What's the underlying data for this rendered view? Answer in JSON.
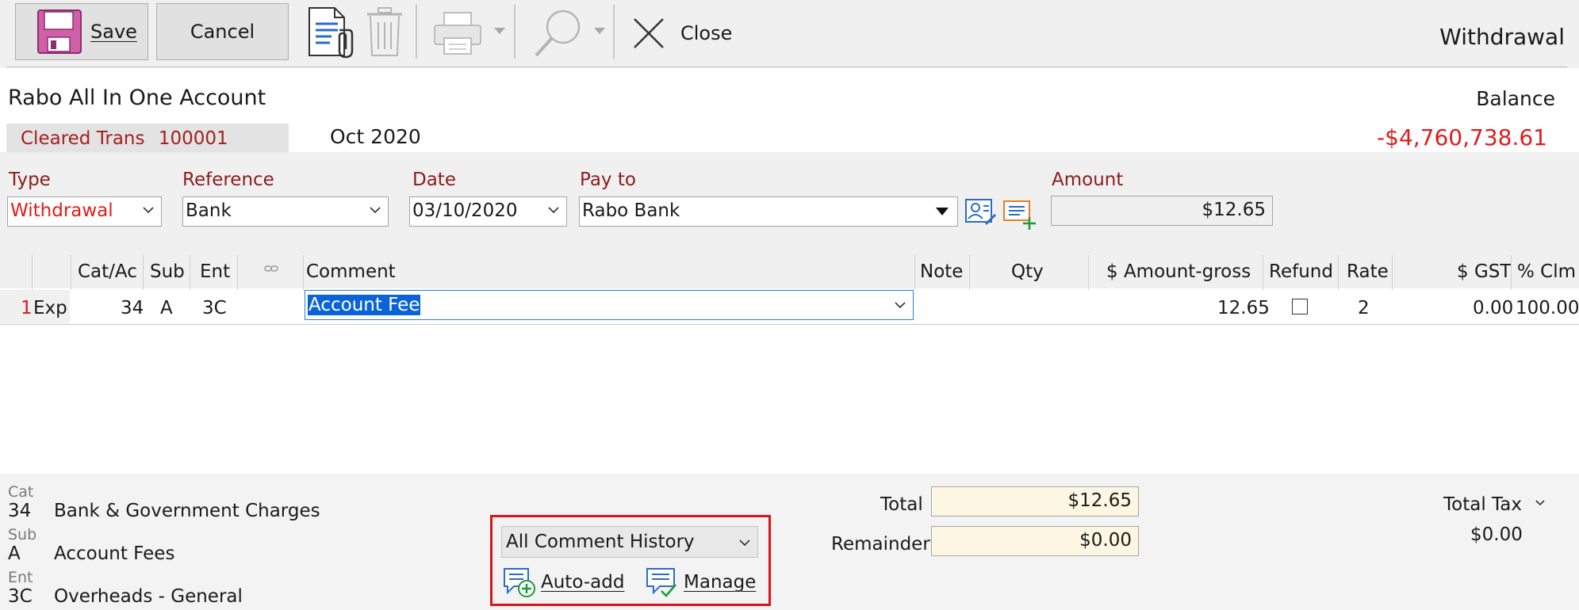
{
  "toolbar": {
    "save_label": "Save",
    "cancel_label": "Cancel",
    "close_label": "Close",
    "window_title": "Withdrawal"
  },
  "header": {
    "account_name": "Rabo All In One Account",
    "cleared_label": "Cleared Trans",
    "cleared_number": "100001",
    "period": "Oct 2020",
    "balance_label": "Balance",
    "balance_value": "-$4,760,738.61"
  },
  "fields": {
    "type_label": "Type",
    "type_value": "Withdrawal",
    "reference_label": "Reference",
    "reference_value": "Bank",
    "date_label": "Date",
    "date_value": "03/10/2020",
    "payto_label": "Pay to",
    "payto_value": "Rabo Bank",
    "amount_label": "Amount",
    "amount_value": "$12.65"
  },
  "grid": {
    "columns": [
      "Cat/Ac",
      "Sub",
      "Ent",
      "Comment",
      "Note",
      "Qty",
      "$ Amount-gross",
      "Refund",
      "Rate",
      "$ GST",
      "% Clm"
    ],
    "rows": [
      {
        "num": "1",
        "kind": "Exp",
        "cat": "34",
        "sub": "A",
        "ent": "3C",
        "comment": "Account Fee",
        "note": "",
        "qty": "",
        "amount": "12.65",
        "rate": "2",
        "gst": "0.00",
        "clm": "100.00"
      }
    ]
  },
  "footer": {
    "cat_label": "Cat",
    "cat_code": "34",
    "cat_desc": "Bank  & Government Charges",
    "sub_label": "Sub",
    "sub_code": "A",
    "sub_desc": "Account Fees",
    "ent_label": "Ent",
    "ent_code": "3C",
    "ent_desc": "Overheads - General",
    "history_value": "All Comment History",
    "autoadd_label": "Auto-add",
    "manage_label": "Manage",
    "total_label": "Total",
    "total_value": "$12.65",
    "remainder_label": "Remainder",
    "remainder_value": "$0.00",
    "total_tax_label": "Total Tax",
    "total_tax_value": "$0.00"
  },
  "colors": {
    "accent_red": "#8c1c1c",
    "balance_red": "#e21b1b",
    "highlight": "#d9151b",
    "selection": "#0a64d7"
  }
}
